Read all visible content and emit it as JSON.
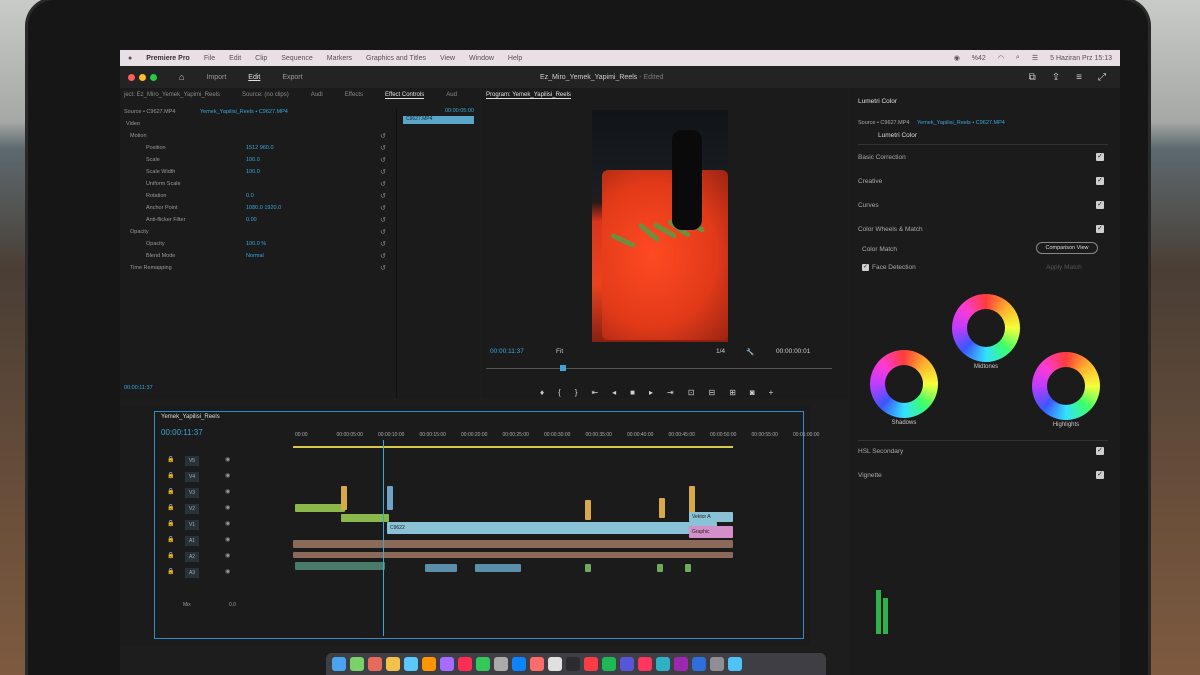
{
  "menubar": {
    "app": "Premiere Pro",
    "items": [
      "File",
      "Edit",
      "Clip",
      "Sequence",
      "Markers",
      "Graphics and Titles",
      "View",
      "Window",
      "Help"
    ],
    "status_pct": "%42",
    "datetime": "5 Haziran Prz  15:13"
  },
  "header": {
    "nav": [
      "Import",
      "Edit",
      "Export"
    ],
    "active": "Edit",
    "doc_title": "Ez_Miro_Yemek_Yapimi_Reels",
    "doc_state": "- Edited"
  },
  "source_tabs": [
    "ject: Ez_Miro_Yemek_Yapimi_Reels",
    "Source: (no clips)",
    "Audi",
    "Effects",
    "Effect Controls",
    "Aud"
  ],
  "effect_controls": {
    "source": "Source • C9627.MP4",
    "clip": "Yemek_Yapilisi_Reels • C9627.MP4",
    "timecode": "00:00:05:00",
    "clip_chip": "C9627.MP4",
    "section_video": "Video",
    "rows": [
      {
        "label": "Motion",
        "value": ""
      },
      {
        "label": "Position",
        "value": "1512   960.0"
      },
      {
        "label": "Scale",
        "value": "100.0"
      },
      {
        "label": "Scale Width",
        "value": "100.0"
      },
      {
        "label": "Uniform Scale",
        "value": ""
      },
      {
        "label": "Rotation",
        "value": "0.0"
      },
      {
        "label": "Anchor Point",
        "value": "1080.0  1920.0"
      },
      {
        "label": "Anti-flicker Filter",
        "value": "0.00"
      },
      {
        "label": "Opacity",
        "value": ""
      },
      {
        "label": "Opacity",
        "value": "100.0 %"
      },
      {
        "label": "Blend Mode",
        "value": "Normal"
      },
      {
        "label": "Time Remapping",
        "value": ""
      }
    ],
    "footer_tc": "00:00:11:37"
  },
  "program": {
    "tab": "Program: Yemek_Yapilisi_Reels",
    "timecode": "00:00:11:37",
    "fit": "Fit",
    "ratio": "1/4",
    "end_tc": "00:00:00:01"
  },
  "lumetri": {
    "title": "Lumetri Color",
    "source": "Source • C9627.MP4",
    "clip": "Yemek_Yapilisi_Reels • C9627.MP4",
    "effect": "Lumetri Color",
    "sections": [
      "Basic Correction",
      "Creative",
      "Curves",
      "Color Wheels & Match"
    ],
    "color_match": "Color Match",
    "comparison_view": "Comparison View",
    "face_detection": "Face Detection",
    "apply_match": "Apply Match",
    "wheels": [
      "Midtones",
      "Shadows",
      "Highlights"
    ],
    "bottom_sections": [
      "HSL Secondary",
      "Vignette"
    ]
  },
  "timeline": {
    "seq_name": "Yemek_Yapilisi_Reels",
    "timecode": "00:00:11:37",
    "ruler": [
      "00:00",
      "00:00:05:00",
      "00:00:10:00",
      "00:00:15:00",
      "00:00:20:00",
      "00:00:25:00",
      "00:00:30:00",
      "00:00:35:00",
      "00:00:40:00",
      "00:00:45:00",
      "00:00:50:00",
      "00:00:55:00",
      "00:01:00:00"
    ],
    "video_tracks": [
      "V5",
      "V4",
      "V3",
      "V2",
      "V1"
    ],
    "audio_tracks": [
      "A1",
      "A2",
      "A3"
    ],
    "mix_label": "Mix",
    "mix_value": "0.0",
    "clip_labels": [
      "C9622",
      "Vektor A",
      "Graphic"
    ]
  },
  "colors": {
    "accent": "#3aa7d9",
    "clip_blue": "#8ac3d6",
    "clip_pink": "#d48ec9",
    "clip_green": "#8ab84a"
  }
}
